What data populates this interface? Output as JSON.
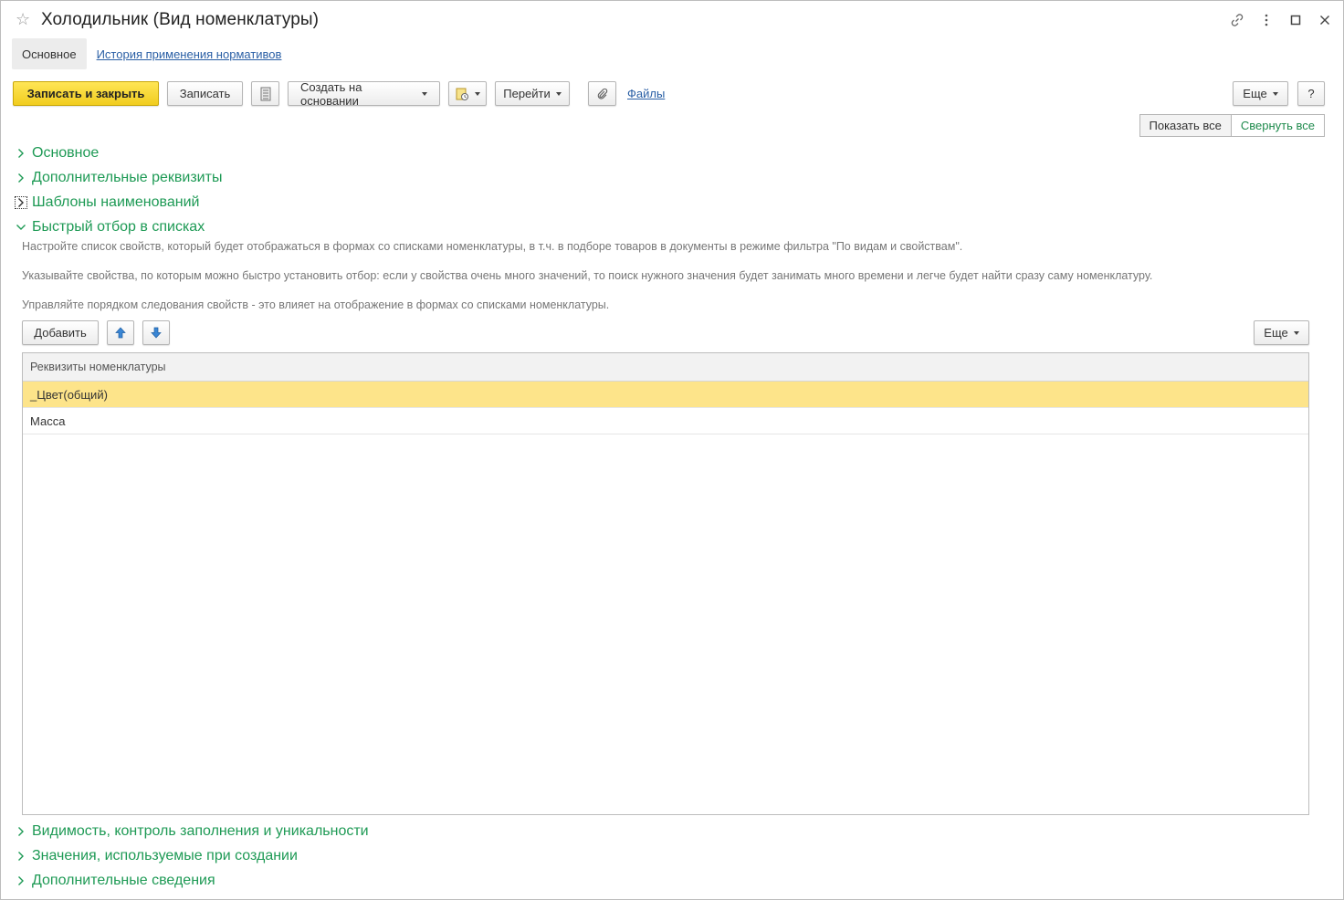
{
  "window": {
    "title": "Холодильник (Вид номенклатуры)",
    "icons": [
      "star-icon",
      "link-icon",
      "more-vertical-icon",
      "maximize-icon",
      "close-icon"
    ]
  },
  "tabs": {
    "active": "Основное",
    "link": "История применения нормативов"
  },
  "toolbar": {
    "save_close": "Записать и закрыть",
    "save": "Записать",
    "create_based": "Создать на основании",
    "goto": "Перейти",
    "files": "Файлы",
    "more": "Еще",
    "help": "?"
  },
  "view_toggle": {
    "show_all": "Показать все",
    "collapse_all": "Свернуть все"
  },
  "groups_top": [
    {
      "label": "Основное",
      "expanded": false
    },
    {
      "label": "Дополнительные реквизиты",
      "expanded": false
    },
    {
      "label": "Шаблоны наименований",
      "expanded": false
    },
    {
      "label": "Быстрый отбор в списках",
      "expanded": true
    }
  ],
  "quick_filter": {
    "desc1": "Настройте список свойств, который будет отображаться в формах со списками номенклатуры, в т.ч. в подборе товаров в документы в режиме фильтра \"По видам и свойствам\".",
    "desc2": "Указывайте свойства, по которым можно быстро установить отбор: если у свойства очень много значений, то поиск нужного значения будет занимать много времени и легче будет найти сразу саму номенклатуру.",
    "desc3": "Управляйте порядком следования свойств - это влияет на отображение в формах со списками номенклатуры.",
    "add": "Добавить",
    "more": "Еще",
    "table": {
      "header": "Реквизиты номенклатуры",
      "rows": [
        "_Цвет(общий)",
        "Масса"
      ],
      "selected_index": 0
    }
  },
  "groups_bottom": [
    {
      "label": "Видимость, контроль заполнения и уникальности"
    },
    {
      "label": "Значения, используемые при создании"
    },
    {
      "label": "Дополнительные сведения"
    }
  ],
  "colors": {
    "accent_green": "#1e9a55",
    "primary_yellow": "#f1cd1f",
    "selected_row": "#fde48a",
    "link_blue": "#2a5fa5"
  }
}
